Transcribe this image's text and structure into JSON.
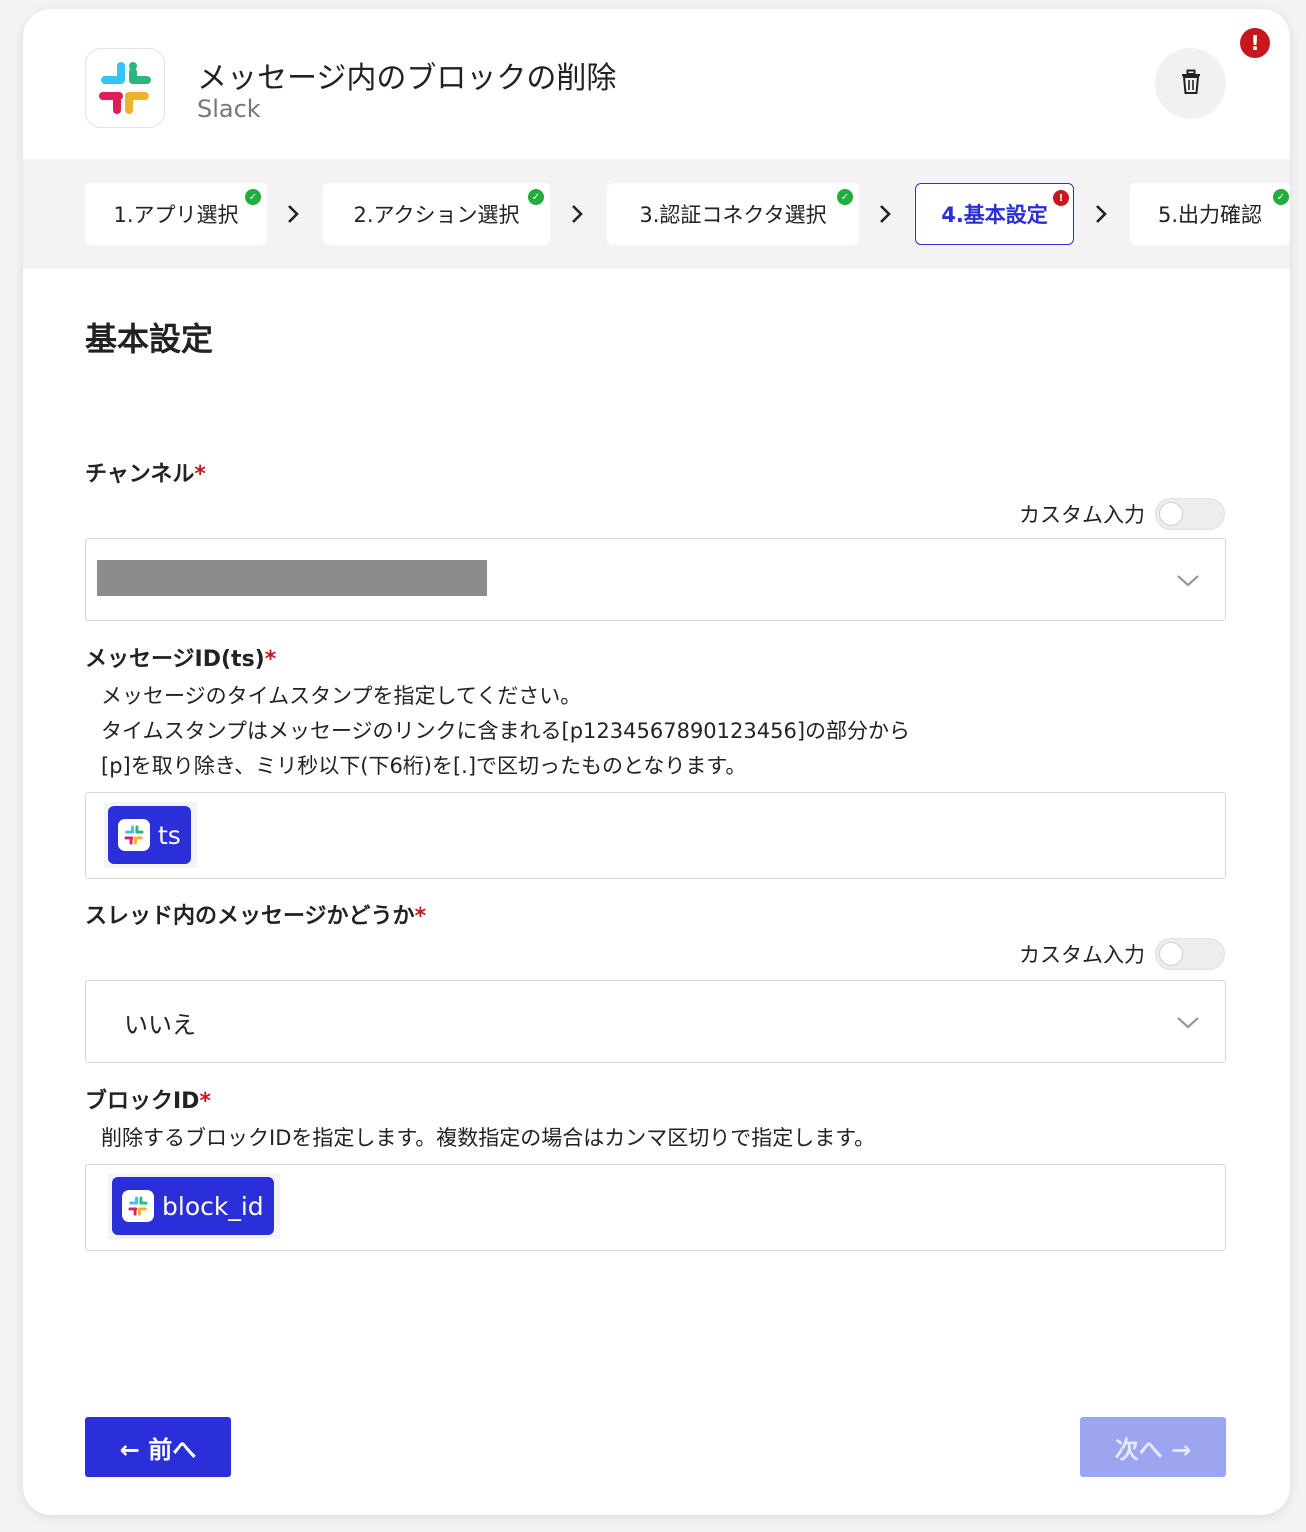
{
  "header": {
    "title": "メッセージ内のブロックの削除",
    "app_name": "Slack",
    "error_badge": "!"
  },
  "stepper": {
    "steps": [
      {
        "label": "1.アプリ選択",
        "status": "done"
      },
      {
        "label": "2.アクション選択",
        "status": "done"
      },
      {
        "label": "3.認証コネクタ選択",
        "status": "done"
      },
      {
        "label": "4.基本設定",
        "status": "error"
      },
      {
        "label": "5.出力確認",
        "status": "done"
      }
    ]
  },
  "section": {
    "title": "基本設定"
  },
  "fields": {
    "channel": {
      "label": "チャンネル",
      "required_mark": "*",
      "custom_input_label": "カスタム入力"
    },
    "message_id": {
      "label": "メッセージID(ts)",
      "required_mark": "*",
      "help_lines": [
        "メッセージのタイムスタンプを指定してください。",
        "タイムスタンプはメッセージのリンクに含まれる[p1234567890123456]の部分から",
        "[p]を取り除き、ミリ秒以下(下6桁)を[.]で区切ったものとなります。"
      ],
      "chip": "ts"
    },
    "in_thread": {
      "label": "スレッド内のメッセージかどうか",
      "required_mark": "*",
      "custom_input_label": "カスタム入力",
      "value": "いいえ"
    },
    "block_id": {
      "label": "ブロックID",
      "required_mark": "*",
      "help": "削除するブロックIDを指定します。複数指定の場合はカンマ区切りで指定します。",
      "chip": "block_id"
    }
  },
  "footer": {
    "prev_label": "← 前へ",
    "next_label": "次へ →"
  },
  "colors": {
    "accent": "#2b2fd9",
    "error": "#c8161d",
    "success": "#1fad3b",
    "disabled": "#9ea5f0"
  }
}
